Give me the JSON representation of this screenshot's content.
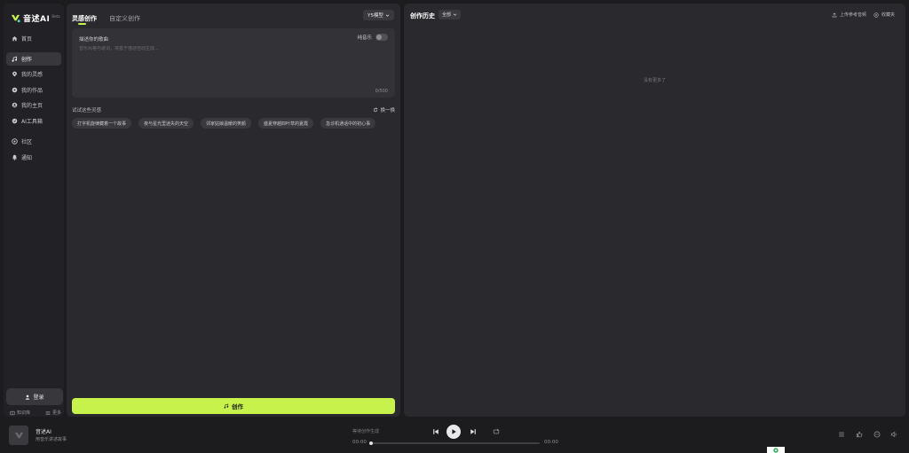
{
  "app": {
    "name": "音述AI",
    "badge": "Beta"
  },
  "sidebar": {
    "items": [
      {
        "label": "首页",
        "icon": "home-icon",
        "active": false
      },
      {
        "label": "创作",
        "icon": "music-create-icon",
        "active": true
      },
      {
        "label": "我的灵感",
        "icon": "inspiration-icon",
        "active": false
      },
      {
        "label": "我的作品",
        "icon": "works-icon",
        "active": false
      },
      {
        "label": "我的主页",
        "icon": "profile-icon",
        "active": false
      },
      {
        "label": "AI工具箱",
        "icon": "toolbox-icon",
        "active": false
      },
      {
        "label": "社区",
        "icon": "community-icon",
        "active": false
      },
      {
        "label": "通知",
        "icon": "bell-icon",
        "active": false
      }
    ],
    "login_label": "登录",
    "links": {
      "knowledge": "知识库",
      "more": "更多"
    }
  },
  "create": {
    "tabs": [
      {
        "label": "灵感创作",
        "active": true
      },
      {
        "label": "自定义创作",
        "active": false
      }
    ],
    "model": "Y5模型",
    "prompt_label": "描述你的歌曲",
    "instrumental_label": "纯音乐",
    "instrumental_on": false,
    "prompt_placeholder": "音乐风格与歌词，将基于描述自动生成...",
    "prompt_value": "",
    "char_count": "0/500",
    "try_label": "试试这些灵感",
    "refresh_label": "换一换",
    "suggestions": [
      "打字机旋律藏着一个故事",
      "夜与星光里迷失的天空",
      "邻家姑娘温暖的笑颜",
      "盛夏穿越四叶草的夏霞",
      "急诊机通话中的初心事"
    ],
    "create_button": "创作"
  },
  "history": {
    "title": "创作历史",
    "filter": "全部",
    "upload_label": "上传参考音频",
    "favorites_label": "收藏夹",
    "empty_text": "没有更多了"
  },
  "player": {
    "track_title": "音述AI",
    "track_subtitle": "用音乐讲述故事",
    "status": "等待创作生成",
    "current_time": "00:00",
    "total_time": "00:00",
    "progress": 0
  },
  "colors": {
    "accent": "#c7f24c",
    "panel": "#2a292d",
    "background": "#1c1b1e"
  }
}
